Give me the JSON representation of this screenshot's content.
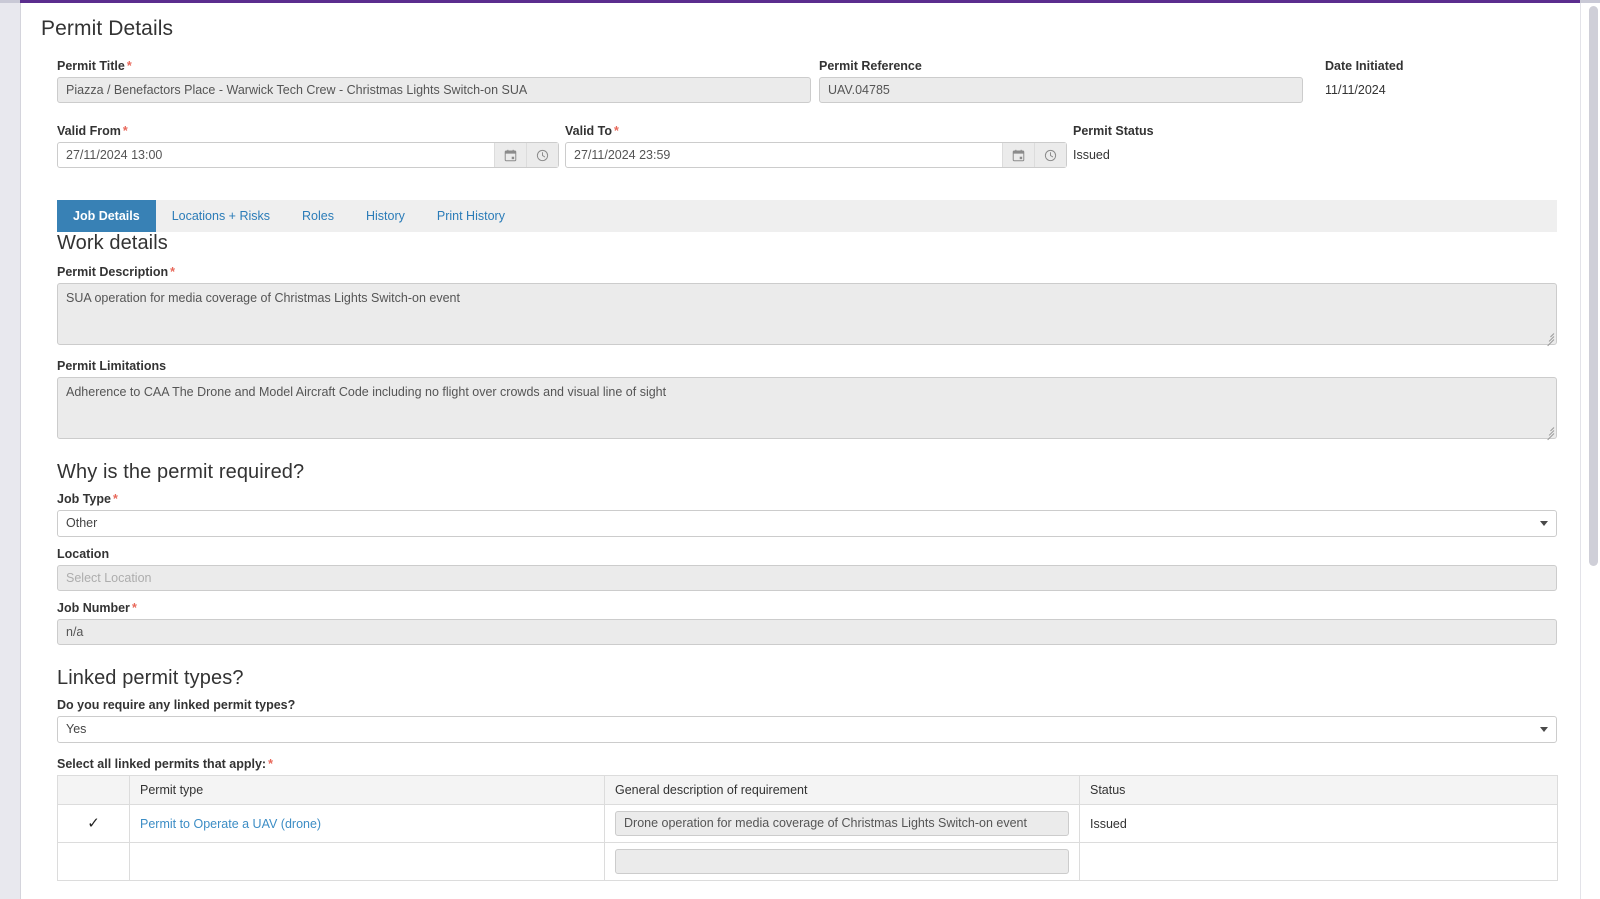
{
  "page": {
    "title": "Permit Details"
  },
  "header": {
    "permit_title": {
      "label": "Permit Title",
      "required": true,
      "value": "Piazza / Benefactors Place - Warwick Tech Crew - Christmas Lights Switch-on SUA"
    },
    "permit_reference": {
      "label": "Permit Reference",
      "required": false,
      "value": "UAV.04785"
    },
    "date_initiated": {
      "label": "Date Initiated",
      "value": "11/11/2024"
    },
    "valid_from": {
      "label": "Valid From",
      "required": true,
      "value": "27/11/2024 13:00"
    },
    "valid_to": {
      "label": "Valid To",
      "required": true,
      "value": "27/11/2024 23:59"
    },
    "permit_status": {
      "label": "Permit Status",
      "value": "Issued"
    }
  },
  "tabs": [
    {
      "label": "Job Details",
      "active": true
    },
    {
      "label": "Locations + Risks",
      "active": false
    },
    {
      "label": "Roles",
      "active": false
    },
    {
      "label": "History",
      "active": false
    },
    {
      "label": "Print History",
      "active": false
    }
  ],
  "work_details": {
    "heading": "Work details",
    "permit_description": {
      "label": "Permit Description",
      "required": true,
      "value": "SUA operation for media coverage of Christmas Lights Switch-on event"
    },
    "permit_limitations": {
      "label": "Permit Limitations",
      "required": false,
      "value": "Adherence to CAA The Drone and Model Aircraft Code including no flight over crowds and visual line of sight"
    }
  },
  "why_required": {
    "heading": "Why is the permit required?",
    "job_type": {
      "label": "Job Type",
      "required": true,
      "value": "Other"
    },
    "location": {
      "label": "Location",
      "required": false,
      "placeholder": "Select Location",
      "value": ""
    },
    "job_number": {
      "label": "Job Number",
      "required": true,
      "value": "n/a"
    }
  },
  "linked_permits": {
    "heading": "Linked permit types?",
    "require_question": {
      "label": "Do you require any linked permit types?",
      "value": "Yes"
    },
    "select_label": "Select all linked permits that apply:",
    "select_required": true,
    "columns": [
      "",
      "Permit type",
      "General description of requirement",
      "Status"
    ],
    "rows": [
      {
        "checked": true,
        "check_glyph": "✓",
        "permit_type": "Permit to Operate a UAV (drone)",
        "description": "Drone operation for media coverage of Christmas Lights Switch-on event",
        "status": "Issued"
      },
      {
        "checked": false,
        "check_glyph": "",
        "permit_type": "",
        "description": "",
        "status": ""
      }
    ]
  },
  "colors": {
    "accent_purple": "#5b2d8e",
    "tab_active": "#3881b5",
    "link": "#3c8dc5",
    "required_star": "#e8685a"
  }
}
